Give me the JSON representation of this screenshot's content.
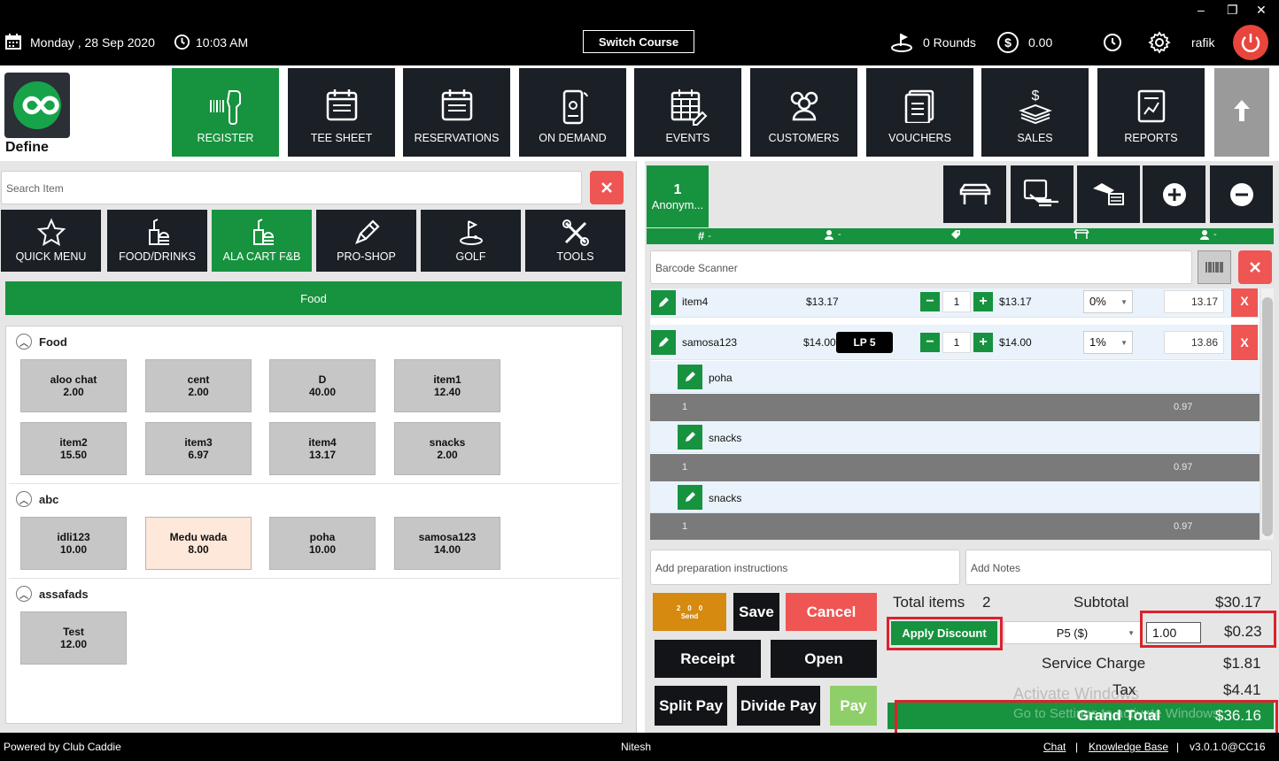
{
  "topbar": {
    "date": "Monday ,  28 Sep 2020",
    "time": "10:03 AM",
    "switch_course": "Switch Course",
    "rounds": "0 Rounds",
    "amount": "0.00",
    "user": "rafik",
    "window_controls": [
      "–",
      "❐",
      "✕"
    ]
  },
  "brand": {
    "label": "Define"
  },
  "nav": [
    {
      "label": "REGISTER",
      "icon": "barcode-scanner-icon",
      "active": true
    },
    {
      "label": "TEE SHEET",
      "icon": "tee-sheet-icon"
    },
    {
      "label": "RESERVATIONS",
      "icon": "reservations-icon"
    },
    {
      "label": "ON DEMAND",
      "icon": "phone-icon"
    },
    {
      "label": "EVENTS",
      "icon": "calendar-edit-icon"
    },
    {
      "label": "CUSTOMERS",
      "icon": "users-icon"
    },
    {
      "label": "VOUCHERS",
      "icon": "voucher-icon"
    },
    {
      "label": "SALES",
      "icon": "money-stack-icon"
    },
    {
      "label": "REPORTS",
      "icon": "report-icon"
    }
  ],
  "search": {
    "placeholder": "Search Item"
  },
  "categories": [
    {
      "label": "QUICK MENU",
      "icon": "star-icon"
    },
    {
      "label": "FOOD/DRINKS",
      "icon": "food-drink-icon"
    },
    {
      "label": "ALA CART F&B",
      "icon": "food-drink-icon",
      "active": true
    },
    {
      "label": "PRO-SHOP",
      "icon": "pen-tool-icon"
    },
    {
      "label": "GOLF",
      "icon": "golf-icon"
    },
    {
      "label": "TOOLS",
      "icon": "tools-icon"
    }
  ],
  "food_header": "Food",
  "sections": [
    {
      "name": "Food",
      "items": [
        {
          "name": "aloo chat",
          "price": "2.00"
        },
        {
          "name": "cent",
          "price": "2.00"
        },
        {
          "name": "D",
          "price": "40.00"
        },
        {
          "name": "item1",
          "price": "12.40"
        },
        {
          "name": "item2",
          "price": "15.50"
        },
        {
          "name": "item3",
          "price": "6.97"
        },
        {
          "name": "item4",
          "price": "13.17"
        },
        {
          "name": "snacks",
          "price": "2.00"
        }
      ]
    },
    {
      "name": "abc",
      "items": [
        {
          "name": "idli123",
          "price": "10.00"
        },
        {
          "name": "Medu wada",
          "price": "8.00"
        },
        {
          "name": "poha",
          "price": "10.00"
        },
        {
          "name": "samosa123",
          "price": "14.00"
        }
      ]
    },
    {
      "name": "assafads",
      "items": [
        {
          "name": "Test",
          "price": "12.00"
        }
      ]
    }
  ],
  "order": {
    "tab_number": "1",
    "tab_name": "Anonym...",
    "strip": [
      "# -",
      "-",
      "-",
      "-",
      "-"
    ],
    "barcode_placeholder": "Barcode Scanner",
    "lines": [
      {
        "name": "item4",
        "price": "$13.17",
        "qty": "1",
        "line_total": "$13.17",
        "discount": "0%",
        "amount": "13.17"
      },
      {
        "name": "samosa123",
        "price": "$14.00",
        "badge": "LP 5",
        "qty": "1",
        "line_total": "$14.00",
        "discount": "1%",
        "amount": "13.86"
      }
    ],
    "modifiers": [
      {
        "name": "poha",
        "qty": "1",
        "price": "0.97"
      },
      {
        "name": "snacks",
        "qty": "1",
        "price": "0.97"
      },
      {
        "name": "snacks",
        "qty": "1",
        "price": "0.97"
      }
    ],
    "prep_placeholder": "Add preparation instructions",
    "notes_placeholder": "Add Notes"
  },
  "send": {
    "a": "2",
    "b": "0",
    "c": "0",
    "label": "Send"
  },
  "actions": {
    "save": "Save",
    "cancel": "Cancel",
    "receipt": "Receipt",
    "open": "Open",
    "split_pay": "Split Pay",
    "divide_pay": "Divide Pay",
    "pay": "Pay"
  },
  "totals": {
    "total_items_label": "Total items",
    "total_items": "2",
    "subtotal_label": "Subtotal",
    "subtotal": "$30.17",
    "apply_discount": "Apply Discount",
    "discount_type": "P5 ($)",
    "discount_input": "1.00",
    "discount_amount": "$0.23",
    "service_charge_label": "Service Charge",
    "service_charge": "$1.81",
    "tax_label": "Tax",
    "tax": "$4.41",
    "grand_total_label": "Grand Total",
    "grand_total": "$36.16"
  },
  "watermark": {
    "line1": "Activate Windows",
    "line2": "Go to Settings to activate Windows."
  },
  "footer": {
    "powered": "Powered by Club Caddie",
    "user": "Nitesh",
    "chat": "Chat",
    "sep1": "|",
    "kb": "Knowledge Base",
    "sep2": "|",
    "version": "v3.0.1.0@CC16"
  },
  "colors": {
    "green": "#17923f",
    "dark": "#1b1f26",
    "red": "#ef5552",
    "orange": "#d68a10"
  }
}
